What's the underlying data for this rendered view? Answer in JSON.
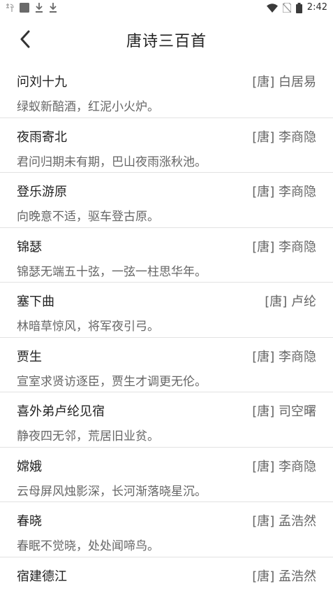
{
  "status_bar": {
    "time": "2:42",
    "left_icons": [
      "poem-app-notification-icon",
      "square-notification-icon",
      "download-icon",
      "download-icon"
    ],
    "right_icons": [
      "wifi-icon",
      "no-sim-icon",
      "battery-icon"
    ]
  },
  "header": {
    "title": "唐诗三百首",
    "back_icon": "chevron-left-icon"
  },
  "poems": [
    {
      "title": "问刘十九",
      "author": "[唐] 白居易",
      "line": "绿蚁新醅酒，红泥小火炉。"
    },
    {
      "title": "夜雨寄北",
      "author": "[唐] 李商隐",
      "line": "君问归期未有期，巴山夜雨涨秋池。"
    },
    {
      "title": "登乐游原",
      "author": "[唐] 李商隐",
      "line": "向晚意不适，驱车登古原。"
    },
    {
      "title": "锦瑟",
      "author": "[唐] 李商隐",
      "line": "锦瑟无端五十弦，一弦一柱思华年。"
    },
    {
      "title": "塞下曲",
      "author": "[唐] 卢纶",
      "line": "林暗草惊风，将军夜引弓。"
    },
    {
      "title": "贾生",
      "author": "[唐] 李商隐",
      "line": "宣室求贤访逐臣，贾生才调更无伦。"
    },
    {
      "title": "喜外弟卢纶见宿",
      "author": "[唐] 司空曙",
      "line": "静夜四无邻，荒居旧业贫。"
    },
    {
      "title": "嫦娥",
      "author": "[唐] 李商隐",
      "line": "云母屏风烛影深，长河渐落晓星沉。"
    },
    {
      "title": "春晓",
      "author": "[唐] 孟浩然",
      "line": "春眠不觉晓，处处闻啼鸟。"
    },
    {
      "title": "宿建德江",
      "author": "[唐] 孟浩然",
      "line": ""
    }
  ],
  "colors": {
    "title_text": "#222222",
    "secondary_text": "#666666",
    "divider": "#e2e2e2",
    "background": "#ffffff"
  }
}
